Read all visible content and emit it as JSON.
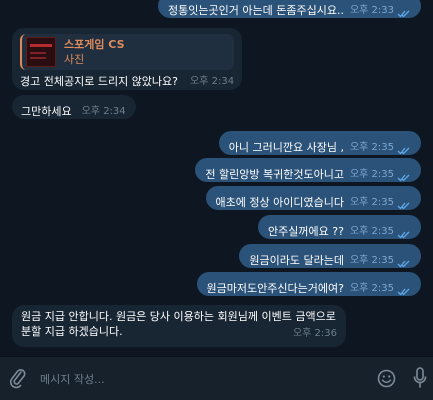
{
  "messages": [
    {
      "text": "정통잇는곳인거 아는데 돈좀주십시요..",
      "time": "오후 2:33"
    },
    {
      "reply_name": "스포게임 CS",
      "reply_sub": "사진",
      "text": "경고 전체공지로 드리지 않았나요?",
      "time": "오후 2:34"
    },
    {
      "text": "그만하세요",
      "time": "오후 2:34"
    },
    {
      "text": "아니 그러니깐요 사장님 ,",
      "time": "오후 2:35"
    },
    {
      "text": "전 할린앙방 복귀한것도아니고",
      "time": "오후 2:35"
    },
    {
      "text": "애초에 정상 아이디였습니다",
      "time": "오후 2:35"
    },
    {
      "text": "안주실꺼에요 ??",
      "time": "오후 2:35"
    },
    {
      "text": "원금이라도 달라는데",
      "time": "오후 2:35"
    },
    {
      "text": "원금마저도안주신다는거에여?",
      "time": "오후 2:35"
    },
    {
      "line1": "원금 지급 안합니다. 원금은 당사 이용하는 회원님께 이벤트 금액으로",
      "line2": "분할 지급 하겠습니다.",
      "time": "오후 2:36"
    }
  ],
  "composer": {
    "placeholder": "메시지 작성..."
  },
  "icons": {
    "attach": "paperclip-icon",
    "emoji": "emoji-icon",
    "mic": "microphone-icon",
    "read": "double-check-icon"
  },
  "colors": {
    "background": "#0e1621",
    "incoming": "#182533",
    "outgoing": "#2b5278",
    "accent": "#e08a5c",
    "check": "#5fa8e8"
  }
}
